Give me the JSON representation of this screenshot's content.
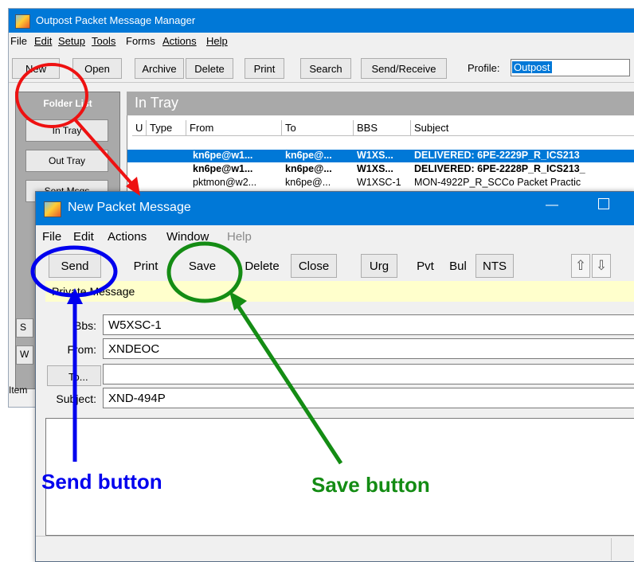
{
  "background_window": {
    "title": "Outpost Packet Message Manager",
    "menu": [
      "File",
      "Edit",
      "Setup",
      "Tools",
      "Forms",
      "Actions",
      "Help"
    ],
    "toolbar": {
      "new": "New",
      "open": "Open",
      "archive": "Archive",
      "delete": "Delete",
      "print": "Print",
      "search": "Search",
      "send_receive": "Send/Receive",
      "profile_label": "Profile:",
      "profile_value": "Outpost"
    },
    "folder_list": {
      "header": "Folder List",
      "items": [
        "In Tray",
        "Out Tray",
        "Sent Msgs"
      ]
    },
    "tray_title": "In Tray",
    "columns": [
      "U",
      "Type",
      "From",
      "To",
      "BBS",
      "Subject"
    ],
    "rows": [
      {
        "from": "kn6pe@w1...",
        "to": "kn6pe@...",
        "bbs": "W1XS...",
        "subject": "DELIVERED: 6PE-2229P_R_ICS213",
        "selected": true,
        "bold": true
      },
      {
        "from": "kn6pe@w1...",
        "to": "kn6pe@...",
        "bbs": "W1XS...",
        "subject": "DELIVERED: 6PE-2228P_R_ICS213_",
        "selected": false,
        "bold": true
      },
      {
        "from": "pktmon@w2...",
        "to": "kn6pe@...",
        "bbs": "W1XSC-1",
        "subject": "MON-4922P_R_SCCo Packet Practic",
        "selected": false,
        "bold": false
      }
    ],
    "side_stub_1": "S",
    "side_stub_2": "W",
    "status_text": "Item"
  },
  "message_window": {
    "title": "New Packet Message",
    "menu": [
      "File",
      "Edit",
      "Actions",
      "Window",
      "Help"
    ],
    "toolbar": {
      "send": "Send",
      "print": "Print",
      "save": "Save",
      "delete": "Delete",
      "close": "Close",
      "urg": "Urg",
      "pvt": "Pvt",
      "bul": "Bul",
      "nts": "NTS"
    },
    "private_banner": "Private Message",
    "fields": {
      "bbs_label": "Bbs:",
      "bbs_value": "W5XSC-1",
      "from_label": "From:",
      "from_value": "XNDEOC",
      "to_button": "To...",
      "to_value": "",
      "subject_label": "Subject:",
      "subject_value": "XND-494P"
    }
  },
  "annotations": {
    "send_label": "Send button",
    "save_label": "Save button",
    "colors": {
      "red": "#ee1111",
      "blue": "#0000ee",
      "green": "#148c14"
    }
  }
}
